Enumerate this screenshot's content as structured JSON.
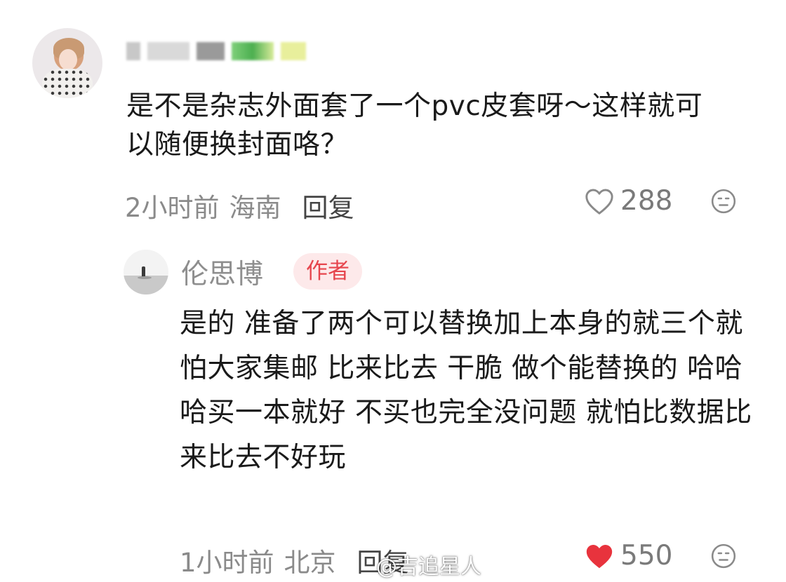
{
  "comment": {
    "text": "是不是杂志外面套了一个pvc皮套呀～这样就可以随便换封面咯？",
    "time": "2小时前",
    "location": "海南",
    "reply_label": "回复",
    "likes": "288"
  },
  "reply": {
    "username": "伦思博",
    "badge": "作者",
    "text": "是的 准备了两个可以替换加上本身的就三个就怕大家集邮 比来比去 干脆 做个能替换的 哈哈哈买一本就好 不买也完全没问题 就怕比数据比来比去不好玩",
    "time": "1小时前",
    "location": "北京",
    "reply_label": "回复",
    "likes": "550"
  },
  "watermark": "@吉追星人",
  "colors": {
    "accent": "#e6454d",
    "badge_bg": "#fde9ea",
    "liked_heart": "#e8333d",
    "meta_gray": "#8a8a8a"
  },
  "icons": {
    "like_outline": "heart-outline-icon",
    "like_filled": "heart-filled-icon",
    "react": "emoji-face-icon"
  }
}
